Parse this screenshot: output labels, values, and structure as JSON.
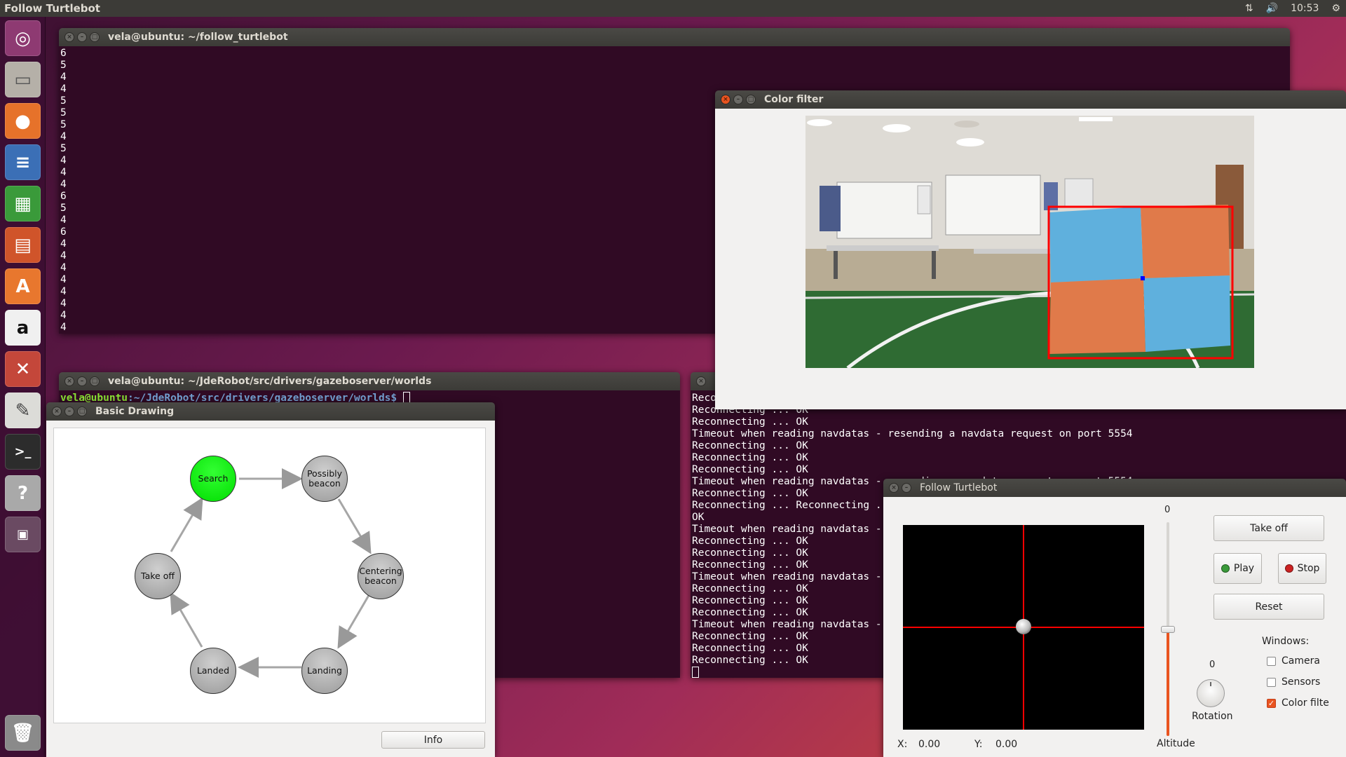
{
  "top_panel": {
    "app_title": "Follow Turtlebot",
    "clock": "10:53"
  },
  "terminal_1": {
    "title": "vela@ubuntu: ~/follow_turtlebot",
    "lines": [
      "6",
      "5",
      "4",
      "4",
      "5",
      "5",
      "5",
      "4",
      "5",
      "4",
      "4",
      "4",
      "6",
      "5",
      "4",
      "6",
      "4",
      "4",
      "4",
      "4",
      "4",
      "4",
      "4",
      "4"
    ]
  },
  "terminal_2": {
    "title": "vela@ubuntu: ~/JdeRobot/src/drivers/gazeboserver/worlds",
    "prompt_user": "vela@ubuntu",
    "prompt_path": ":~/JdeRobot/src/drivers/gazeboserver/worlds$ "
  },
  "terminal_3": {
    "lines": [
      "Reconnecting ... OK",
      "Reconnecting ... OK",
      "Reconnecting ... OK",
      "Timeout when reading navdatas - resending a navdata request on port 5554",
      "Reconnecting ... OK",
      "Reconnecting ... OK",
      "Reconnecting ... OK",
      "Timeout when reading navdatas - resending a navdata request on port 5554",
      "Reconnecting ... OK",
      "Reconnecting ... Reconnecting ... OK",
      "OK",
      "Timeout when reading navdatas -",
      "Reconnecting ... OK",
      "Reconnecting ... OK",
      "Reconnecting ... OK",
      "Timeout when reading navdatas -",
      "Reconnecting ... OK",
      "Reconnecting ... OK",
      "Reconnecting ... OK",
      "Timeout when reading navdatas -",
      "Reconnecting ... OK",
      "Reconnecting ... OK",
      "Reconnecting ... OK"
    ]
  },
  "color_filter": {
    "title": "Color filter"
  },
  "basic_drawing": {
    "title": "Basic Drawing",
    "nodes": {
      "search": "Search",
      "possibly_beacon": "Possibly\nbeacon",
      "centering_beacon": "Centering\nbeacon",
      "landing": "Landing",
      "landed": "Landed",
      "take_off": "Take off"
    },
    "info_button": "Info"
  },
  "follow_turtlebot": {
    "title": "Follow Turtlebot",
    "buttons": {
      "take_off": "Take off",
      "play": "Play",
      "stop": "Stop",
      "reset": "Reset"
    },
    "altitude_value": "0",
    "altitude_label": "Altitude",
    "rotation_value": "0",
    "rotation_label": "Rotation",
    "windows_label": "Windows:",
    "checkboxes": [
      {
        "label": "Camera",
        "checked": false
      },
      {
        "label": "Sensors",
        "checked": false
      },
      {
        "label": "Color filte",
        "checked": true
      }
    ],
    "x_label": "X:",
    "x_value": "0.00",
    "y_label": "Y:",
    "y_value": "0.00"
  },
  "colors": {
    "accent": "#e95420",
    "terminal_bg": "#300a24",
    "active_state": "#00ee00",
    "crosshair": "#ff0000"
  },
  "launcher_icons": [
    "ubuntu-dash-icon",
    "files-icon",
    "firefox-icon",
    "writer-icon",
    "calc-icon",
    "impress-icon",
    "software-center-icon",
    "amazon-icon",
    "settings-icon",
    "text-editor-icon",
    "terminal-icon",
    "help-icon",
    "workspaces-icon",
    "trash-icon"
  ]
}
